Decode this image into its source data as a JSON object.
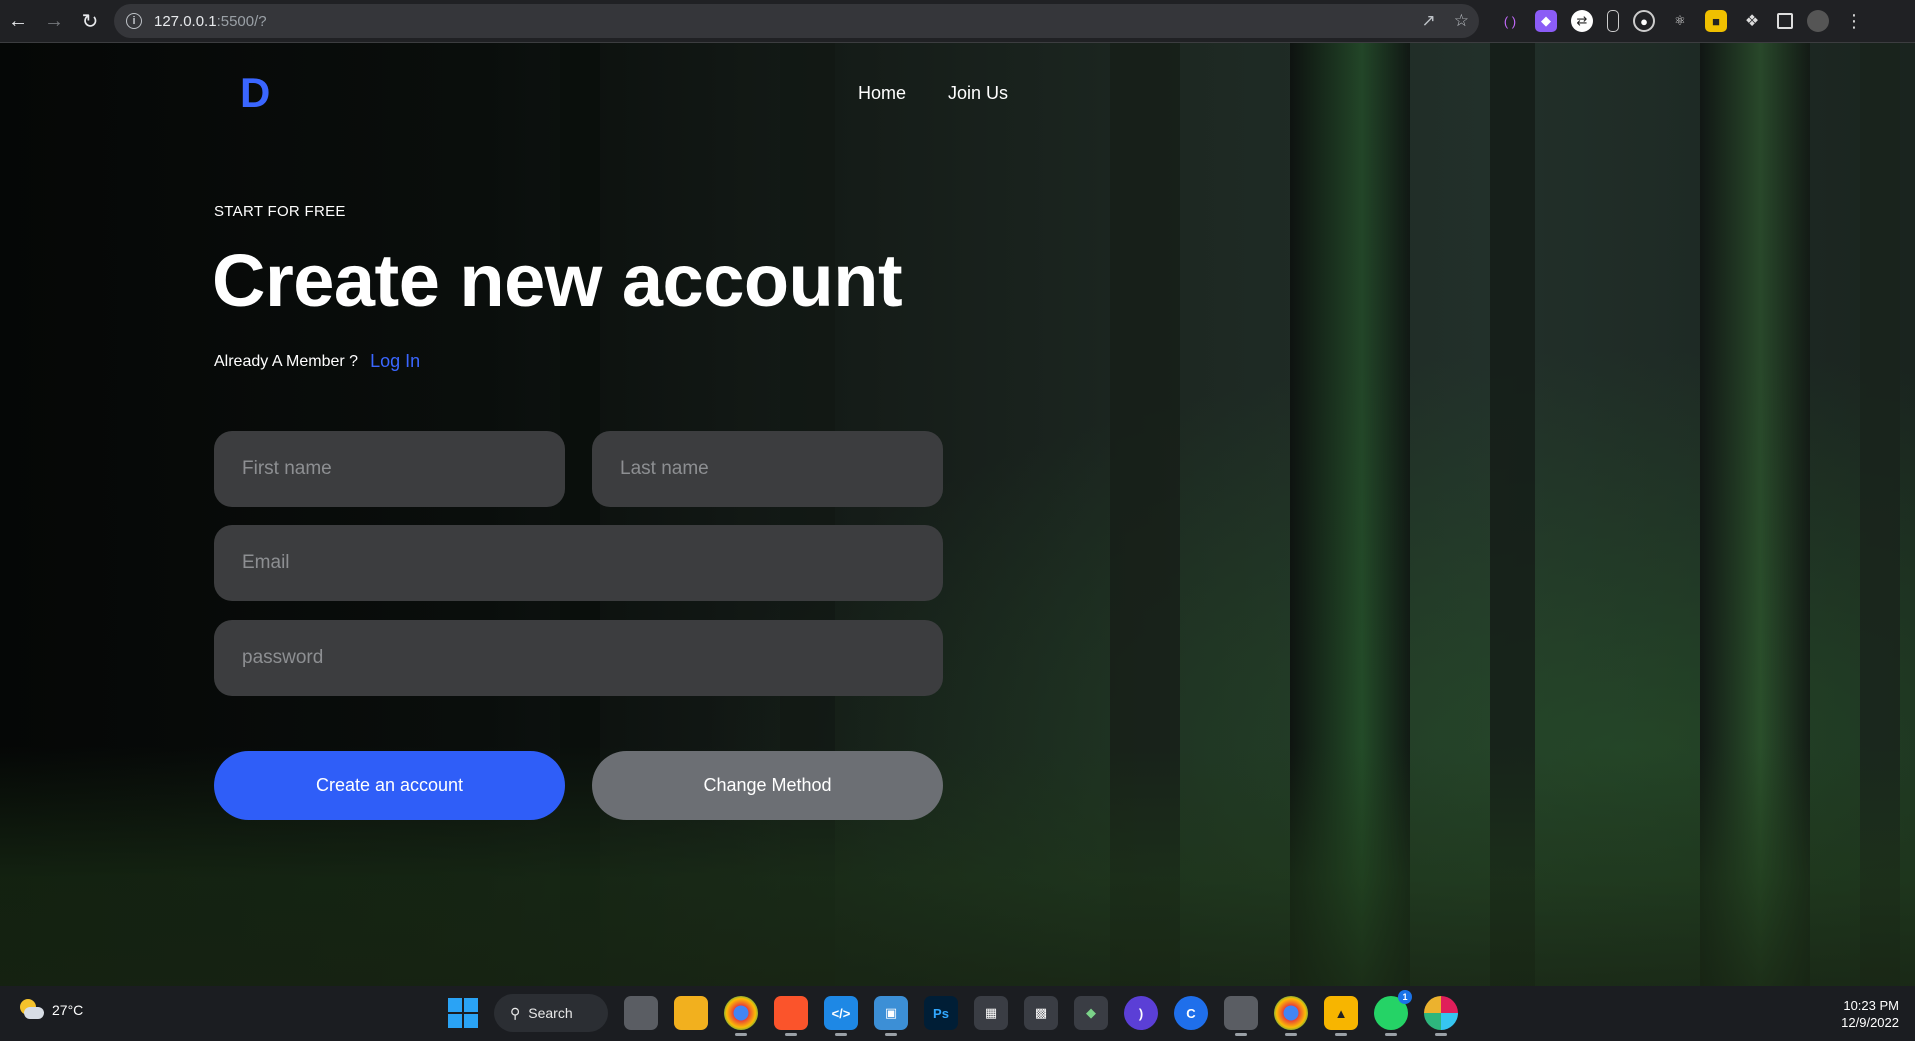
{
  "browser": {
    "url_host": "127.0.0.1",
    "url_path": ":5500/?"
  },
  "site": {
    "logo": "D",
    "nav": [
      {
        "label": "Home"
      },
      {
        "label": "Join Us"
      }
    ]
  },
  "hero": {
    "eyebrow": "START FOR FREE",
    "title": "Create new account",
    "member_text": "Already A Member ?",
    "login_link": "Log In"
  },
  "form": {
    "first_name_placeholder": "First name",
    "last_name_placeholder": "Last name",
    "email_placeholder": "Email",
    "password_placeholder": "password",
    "create_button": "Create an account",
    "change_button": "Change Method"
  },
  "taskbar": {
    "weather": "27°C",
    "search_label": "Search",
    "time": "10:23 PM",
    "date": "12/9/2022",
    "whatsapp_badge": "1"
  },
  "colors": {
    "accent": "#2f5ef8",
    "field_bg": "#3c3d3f",
    "secondary_button": "#6c6f74"
  }
}
